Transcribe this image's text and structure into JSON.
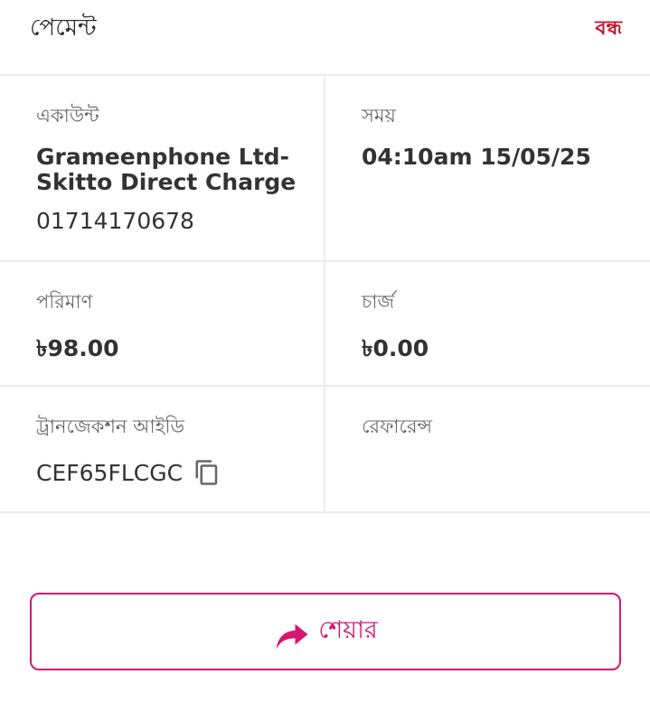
{
  "header": {
    "title": "পেমেন্ট",
    "close_label": "বন্ধ"
  },
  "details": {
    "account": {
      "label": "একাউন্ট",
      "name_line1": "Grameenphone Ltd-",
      "name_line2": "Skitto Direct Charge",
      "number": "01714170678"
    },
    "time": {
      "label": "সময়",
      "value": "04:10am 15/05/25"
    },
    "amount": {
      "label": "পরিমাণ",
      "value": "৳98.00"
    },
    "charge": {
      "label": "চার্জ",
      "value": "৳0.00"
    },
    "transaction": {
      "label": "ট্রানজেকশন আইডি",
      "value": "CEF65FLCGC",
      "copy_icon": "copy-icon"
    },
    "reference": {
      "label": "রেফারেন্স",
      "value": ""
    }
  },
  "share": {
    "label": "শেয়ার",
    "icon": "share-icon"
  },
  "colors": {
    "accent": "#d6166f",
    "close": "#c8102e",
    "divider": "#ececec",
    "text": "#333333",
    "label": "#666666"
  }
}
